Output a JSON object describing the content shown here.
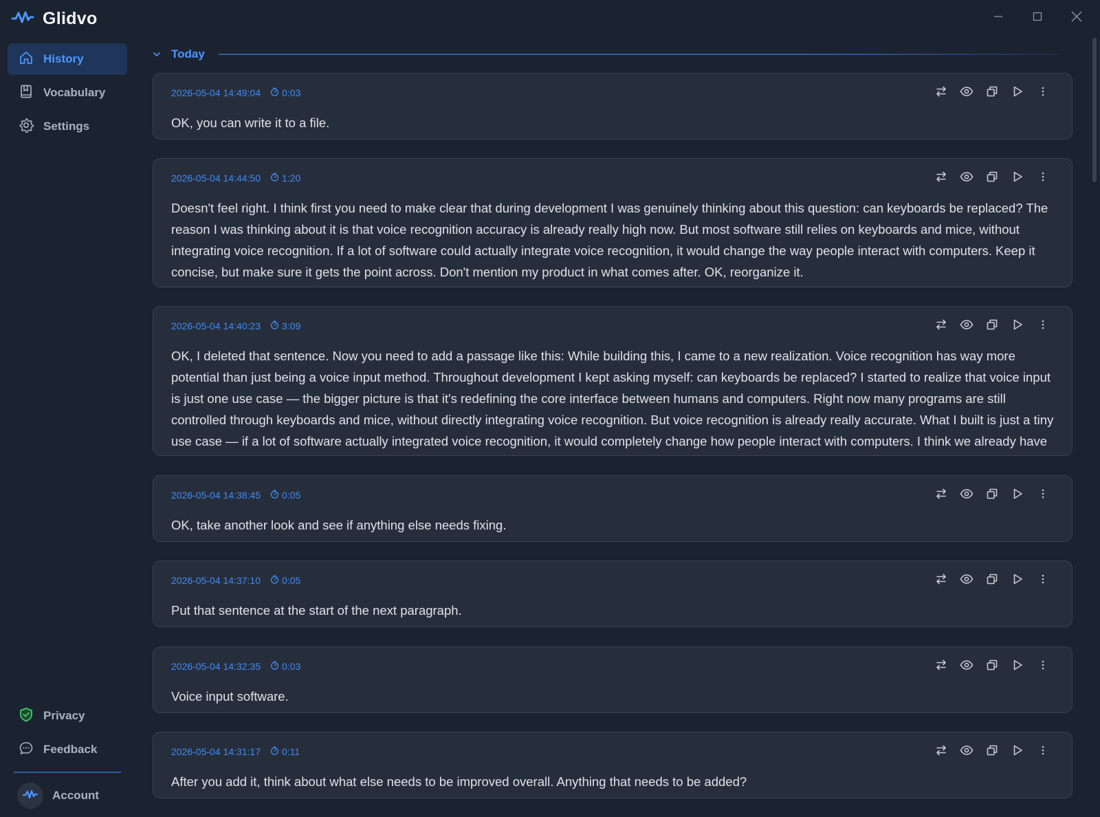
{
  "app": {
    "name": "Glidvo"
  },
  "sidebar": {
    "items": [
      {
        "label": "History",
        "icon": "home-icon",
        "active": true
      },
      {
        "label": "Vocabulary",
        "icon": "book-icon",
        "active": false
      },
      {
        "label": "Settings",
        "icon": "gear-icon",
        "active": false
      }
    ],
    "bottom": [
      {
        "label": "Privacy",
        "icon": "shield-check-icon"
      },
      {
        "label": "Feedback",
        "icon": "chat-bubble-icon"
      }
    ],
    "account": {
      "label": "Account",
      "icon": "waveform-icon"
    }
  },
  "colors": {
    "accent": "#4d97ff",
    "active_bg": "#1f3559",
    "card_bg": "#272e3b",
    "shield": "#3ecf6a"
  },
  "history": {
    "group": "Today",
    "entries": [
      {
        "timestamp": "2026-05-04 14:49:04",
        "duration": "0:03",
        "text": "OK, you can write it to a file."
      },
      {
        "timestamp": "2026-05-04 14:44:50",
        "duration": "1:20",
        "text": "Doesn't feel right. I think first you need to make clear that during development I was genuinely thinking about this question: can keyboards be replaced? The reason I was thinking about it is that voice recognition accuracy is already really high now. But most software still relies on keyboards and mice, without integrating voice recognition. If a lot of software could actually integrate voice recognition, it would change the way people interact with computers. Keep it concise, but make sure it gets the point across. Don't mention my product in what comes after. OK, reorganize it."
      },
      {
        "timestamp": "2026-05-04 14:40:23",
        "duration": "3:09",
        "text": "OK, I deleted that sentence. Now you need to add a passage like this: While building this, I came to a new realization. Voice recognition has way more potential than just being a voice input method. Throughout development I kept asking myself: can keyboards be replaced? I started to realize that voice input is just one use case — the bigger picture is that it's redefining the core interface between humans and computers. Right now many programs are still controlled through keyboards and mice, without directly integrating voice recognition. But voice recognition is already really accurate. What I built is just a tiny use case — if a lot of software actually integrated voice recognition, it would completely change how people interact with computers. I think we already have that capability toda..."
      },
      {
        "timestamp": "2026-05-04 14:38:45",
        "duration": "0:05",
        "text": "OK, take another look and see if anything else needs fixing."
      },
      {
        "timestamp": "2026-05-04 14:37:10",
        "duration": "0:05",
        "text": "Put that sentence at the start of the next paragraph."
      },
      {
        "timestamp": "2026-05-04 14:32:35",
        "duration": "0:03",
        "text": "Voice input software."
      },
      {
        "timestamp": "2026-05-04 14:31:17",
        "duration": "0:11",
        "text": "After you add it, think about what else needs to be improved overall. Anything that needs to be added?"
      }
    ]
  }
}
